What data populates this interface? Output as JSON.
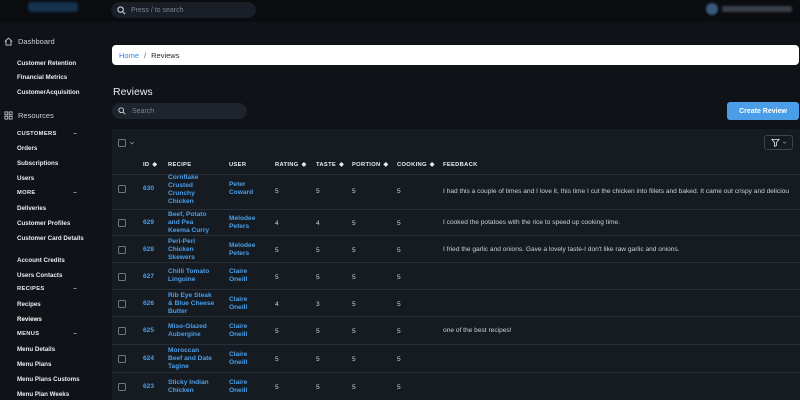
{
  "topbar": {
    "search_placeholder": "Press / to search"
  },
  "sidebar": {
    "dashboard": "Dashboard",
    "dashboard_items": [
      "Customer Retention",
      "Financial Metrics",
      "CustomerAcquisition"
    ],
    "resources": "Resources",
    "sections": [
      {
        "title": "CUSTOMERS",
        "items": [
          "Orders",
          "Subscriptions",
          "Users"
        ]
      },
      {
        "title": "MORE",
        "items": [
          "Deliveries",
          "Customer Profiles",
          "Customer Card Details",
          "Account Credits",
          "Users Contacts"
        ]
      },
      {
        "title": "RECIPES",
        "items": [
          "Recipes",
          "Reviews"
        ]
      },
      {
        "title": "MENUS",
        "items": [
          "Menu Details",
          "Menu Plans",
          "Menu Plans Customs",
          "Menu Plan Weeks"
        ]
      }
    ],
    "active_item": "Reviews"
  },
  "breadcrumb": {
    "home": "Home",
    "current": "Reviews"
  },
  "page": {
    "title": "Reviews",
    "search_placeholder": "Search",
    "create_label": "Create Review"
  },
  "table": {
    "columns": [
      "ID",
      "RECIPE",
      "USER",
      "RATING",
      "TASTE",
      "PORTION",
      "COOKING",
      "FEEDBACK"
    ],
    "rows": [
      {
        "id": "630",
        "recipe": [
          "Cornflake",
          "Crusted",
          "Crunchy",
          "Chicken"
        ],
        "user": [
          "Peter",
          "Coward"
        ],
        "rating": "5",
        "taste": "5",
        "portion": "5",
        "cooking": "5",
        "feedback": "I had this a couple of times and I love it, this time I cut the chicken into fillets and baked. It came out crispy and deliciou"
      },
      {
        "id": "629",
        "recipe": [
          "Beef, Potato",
          "and Pea",
          "Keema Curry"
        ],
        "user": [
          "Melodee",
          "Peters"
        ],
        "rating": "4",
        "taste": "4",
        "portion": "5",
        "cooking": "5",
        "feedback": "I cooked the potatoes with the rice to speed up cooking time."
      },
      {
        "id": "628",
        "recipe": [
          "Peri-Peri",
          "Chicken",
          "Skewers"
        ],
        "user": [
          "Melodee",
          "Peters"
        ],
        "rating": "5",
        "taste": "5",
        "portion": "5",
        "cooking": "5",
        "feedback": "I fried the garlic and onions. Gave a lovely taste-I don't like raw garlic and onions."
      },
      {
        "id": "627",
        "recipe": [
          "Chilli Tomato",
          "Linguine"
        ],
        "user": [
          "Claire",
          "Oneill"
        ],
        "rating": "5",
        "taste": "5",
        "portion": "5",
        "cooking": "5",
        "feedback": ""
      },
      {
        "id": "626",
        "recipe": [
          "Rib Eye Steak",
          "& Blue Cheese",
          "Butter"
        ],
        "user": [
          "Claire",
          "Oneill"
        ],
        "rating": "4",
        "taste": "3",
        "portion": "5",
        "cooking": "5",
        "feedback": ""
      },
      {
        "id": "625",
        "recipe": [
          "Miso-Glazed",
          "Aubergine"
        ],
        "user": [
          "Claire",
          "Oneill"
        ],
        "rating": "5",
        "taste": "5",
        "portion": "5",
        "cooking": "5",
        "feedback": "one of the best recipes!"
      },
      {
        "id": "624",
        "recipe": [
          "Moroccan",
          "Beef and Date",
          "Tagine"
        ],
        "user": [
          "Claire",
          "Oneill"
        ],
        "rating": "5",
        "taste": "5",
        "portion": "5",
        "cooking": "5",
        "feedback": ""
      },
      {
        "id": "623",
        "recipe": [
          "Sticky Indian",
          "Chicken"
        ],
        "user": [
          "Claire",
          "Oneill"
        ],
        "rating": "5",
        "taste": "5",
        "portion": "5",
        "cooking": "5",
        "feedback": ""
      }
    ]
  },
  "colors": {
    "accent": "#4a9ee8",
    "background": "#0f1217",
    "panel": "#161b22"
  }
}
